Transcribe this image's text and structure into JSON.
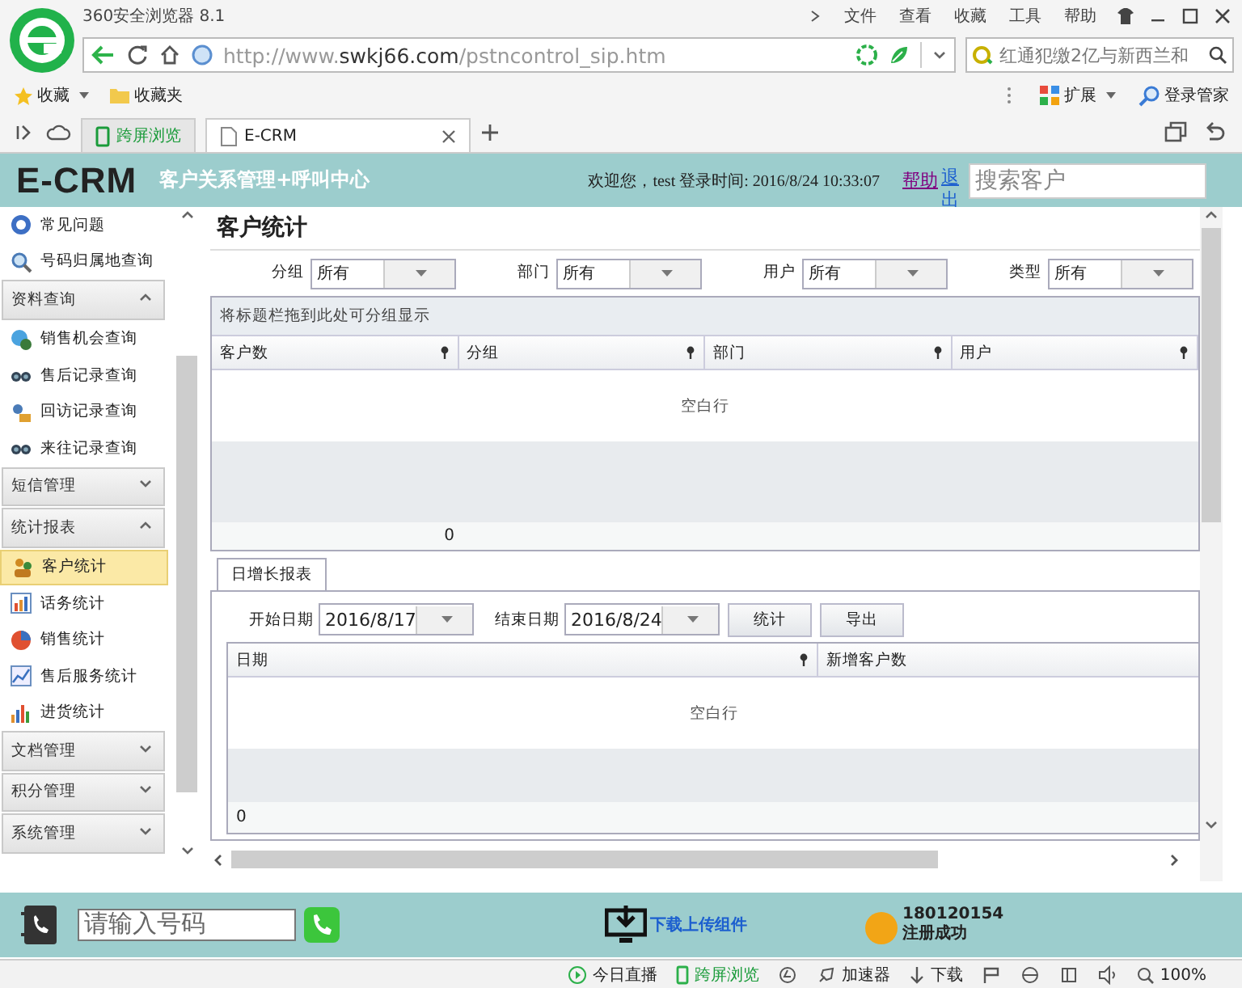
{
  "browser": {
    "title": "360安全浏览器 8.1",
    "menu": [
      "文件",
      "查看",
      "收藏",
      "工具",
      "帮助"
    ],
    "url": "http://www.**swkj66.com**/pstncontrol_sip.htm",
    "search": "红通犯缴2亿与新西兰和",
    "bookmarks": [
      "收藏",
      "收藏夹"
    ],
    "toolbar": [
      "扩展",
      "登录管家"
    ],
    "tabs": [
      {
        "label": "跨屏浏览",
        "selected": false
      },
      {
        "label": "E-CRM",
        "selected": true
      }
    ]
  },
  "header": {
    "logo": "E-CRM",
    "subtitle": "客户关系管理+呼叫中心",
    "welcome": "欢迎您，test 登录时间: 2016/8/24 10:33:07",
    "links": [
      "帮助",
      "退出"
    ],
    "search": {
      "placeholder": "搜索客户"
    }
  },
  "sidebar": {
    "items": [
      {
        "kind": "item",
        "label": "常见问题",
        "selected": false
      },
      {
        "kind": "item",
        "label": "号码归属地查询",
        "selected": false
      },
      {
        "kind": "group",
        "label": "资料查询",
        "expanded": true,
        "children": [
          {
            "label": "销售机会查询",
            "selected": false
          },
          {
            "label": "售后记录查询",
            "selected": false
          },
          {
            "label": "回访记录查询",
            "selected": false
          },
          {
            "label": "来往记录查询",
            "selected": false
          }
        ]
      },
      {
        "kind": "group",
        "label": "短信管理",
        "expanded": false
      },
      {
        "kind": "group",
        "label": "统计报表",
        "expanded": true,
        "children": [
          {
            "label": "客户统计",
            "selected": true
          },
          {
            "label": "话务统计",
            "selected": false
          },
          {
            "label": "销售统计",
            "selected": false
          },
          {
            "label": "售后服务统计",
            "selected": false
          },
          {
            "label": "进货统计",
            "selected": false
          }
        ]
      },
      {
        "kind": "group",
        "label": "文档管理",
        "expanded": false
      },
      {
        "kind": "group",
        "label": "积分管理",
        "expanded": false
      },
      {
        "kind": "group",
        "label": "系统管理",
        "expanded": false
      }
    ]
  },
  "main": {
    "title": "客户统计",
    "filters": [
      {
        "label": "分组",
        "value": "所有"
      },
      {
        "label": "部门",
        "value": "所有"
      },
      {
        "label": "用户",
        "value": "所有"
      },
      {
        "label": "类型",
        "value": "所有"
      }
    ],
    "grid": {
      "group_hint": "将标题栏拖到此处可分组显示",
      "columns": [
        "客户数",
        "分组",
        "部门",
        "用户"
      ],
      "empty": "空白行",
      "total": "0"
    },
    "report_tabs": [
      {
        "label": "日增长报表",
        "selected": true
      }
    ],
    "dates": [
      {
        "label": "开始日期",
        "value": "2016/8/17"
      },
      {
        "label": "结束日期",
        "value": "2016/8/24"
      }
    ],
    "buttons": [
      "统计",
      "导出"
    ],
    "report_grid": {
      "columns": [
        "日期",
        "新增客户数"
      ],
      "empty": "空白行",
      "total": "0"
    }
  },
  "footer": {
    "phone": {
      "placeholder": "请输入号码"
    },
    "download": "下载上传组件",
    "account": "180120154",
    "status": "注册成功"
  },
  "status_bar": [
    "今日直播",
    "跨屏浏览",
    "加速器",
    "下载",
    "100%"
  ]
}
